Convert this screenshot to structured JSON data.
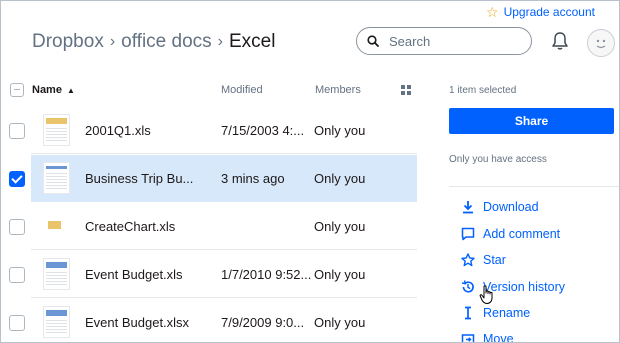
{
  "header": {
    "upgrade_label": "Upgrade account",
    "breadcrumb": [
      "Dropbox",
      "office docs",
      "Excel"
    ],
    "search_placeholder": "Search"
  },
  "table": {
    "columns": {
      "name": "Name",
      "modified": "Modified",
      "members": "Members"
    },
    "rows": [
      {
        "name": "2001Q1.xls",
        "modified": "7/15/2003 4:...",
        "members": "Only you",
        "selected": false
      },
      {
        "name": "Business Trip Bu...",
        "modified": "3 mins ago",
        "members": "Only you",
        "selected": true
      },
      {
        "name": "CreateChart.xls",
        "modified": "",
        "members": "Only you",
        "selected": false
      },
      {
        "name": "Event Budget.xls",
        "modified": "1/7/2010 9:52...",
        "members": "Only you",
        "selected": false
      },
      {
        "name": "Event Budget.xlsx",
        "modified": "7/9/2009 9:0...",
        "members": "Only you",
        "selected": false
      }
    ]
  },
  "panel": {
    "selection_count": "1 item selected",
    "share_label": "Share",
    "access_text": "Only you have access",
    "actions": {
      "download": "Download",
      "add_comment": "Add comment",
      "star": "Star",
      "version_history": "Version history",
      "rename": "Rename",
      "move": "Move"
    }
  },
  "colors": {
    "accent": "#0061fe",
    "selected_row": "#d7e8fb",
    "muted": "#637282"
  }
}
